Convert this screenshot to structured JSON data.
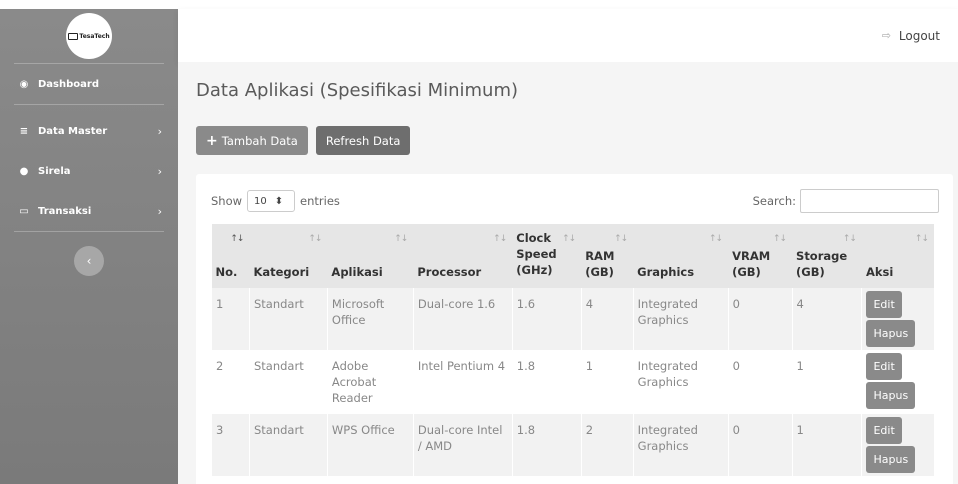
{
  "brand": {
    "logo_text": "TesaTech"
  },
  "sidebar": {
    "items": [
      {
        "label": "Dashboard",
        "icon": "dashboard-icon",
        "chevron": ""
      },
      {
        "label": "Data Master",
        "icon": "database-icon",
        "chevron": "›"
      },
      {
        "label": "Sirela",
        "icon": "lightbulb-icon",
        "chevron": "›"
      },
      {
        "label": "Transaksi",
        "icon": "desktop-icon",
        "chevron": "›"
      }
    ],
    "toggle_glyph": "‹"
  },
  "topbar": {
    "logout_label": "Logout"
  },
  "page": {
    "title": "Data Aplikasi (Spesifikasi Minimum)",
    "add_label": "Tambah Data",
    "refresh_label": "Refresh Data"
  },
  "table_controls": {
    "show_label": "Show",
    "entries_value": "10",
    "entries_label": "entries",
    "search_label": "Search:"
  },
  "table": {
    "headers": [
      "No.",
      "Kategori",
      "Aplikasi",
      "Processor",
      "Clock Speed (GHz)",
      "RAM (GB)",
      "Graphics",
      "VRAM (GB)",
      "Storage (GB)",
      "Aksi"
    ],
    "rows": [
      {
        "no": "1",
        "kategori": "Standart",
        "aplikasi": "Microsoft Office",
        "processor": "Dual-core 1.6",
        "clock": "1.6",
        "ram": "4",
        "graphics": "Integrated Graphics",
        "vram": "0",
        "storage": "4"
      },
      {
        "no": "2",
        "kategori": "Standart",
        "aplikasi": "Adobe Acrobat Reader",
        "processor": "Intel Pentium 4",
        "clock": "1.8",
        "ram": "1",
        "graphics": "Integrated Graphics",
        "vram": "0",
        "storage": "1"
      },
      {
        "no": "3",
        "kategori": "Standart",
        "aplikasi": "WPS Office",
        "processor": "Dual-core Intel / AMD",
        "clock": "1.8",
        "ram": "2",
        "graphics": "Integrated Graphics",
        "vram": "0",
        "storage": "1"
      }
    ],
    "edit_label": "Edit",
    "delete_label": "Hapus"
  },
  "colors": {
    "sidebar": "#808080",
    "button": "#8a8a8a",
    "refresh": "#6e6e6e"
  }
}
